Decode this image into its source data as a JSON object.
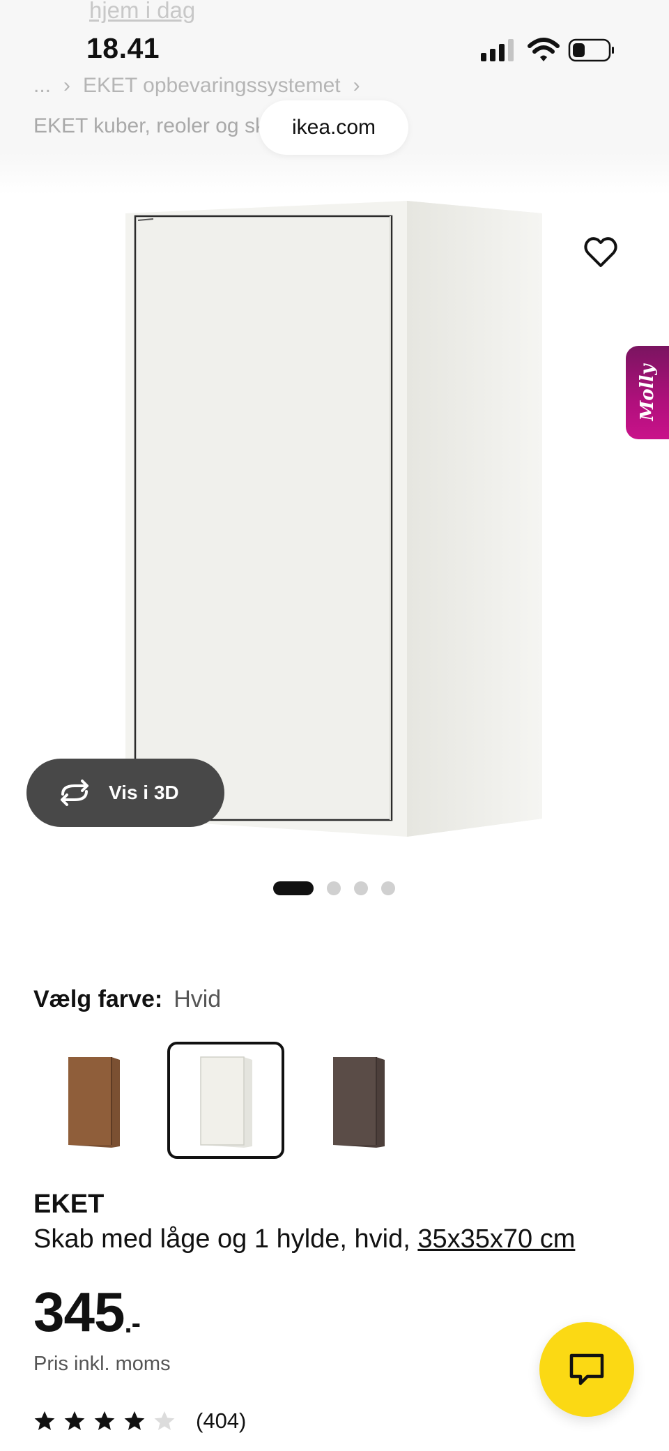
{
  "browser": {
    "previous_link": "hjem i dag",
    "time": "18.41",
    "url": "ikea.com"
  },
  "breadcrumb": {
    "line1": [
      "...",
      "EKET opbevaringssystemet"
    ],
    "line2": "EKET kuber, reoler og sk"
  },
  "gallery": {
    "view_3d_label": "Vis i 3D",
    "dot_count": 4,
    "active_dot": 0
  },
  "assistant": {
    "label": "Molly"
  },
  "colors": {
    "label": "Vælg farve:",
    "selected": "Hvid",
    "swatches": [
      {
        "name": "walnut-brown",
        "hex": "#8b5e3c"
      },
      {
        "name": "white",
        "hex": "#f1f0ea"
      },
      {
        "name": "dark-grey",
        "hex": "#5a4c47"
      }
    ]
  },
  "product": {
    "brand": "EKET",
    "description": "Skab med låge og 1 hylde, hvid,",
    "dimensions": "35x35x70 cm",
    "price": "345",
    "price_suffix": ".-",
    "price_note": "Pris inkl. moms",
    "rating": 4,
    "rating_max": 5,
    "review_count": "(404)"
  },
  "accent": {
    "chat_fab": "#fbd914",
    "molly": "#b0107c"
  }
}
